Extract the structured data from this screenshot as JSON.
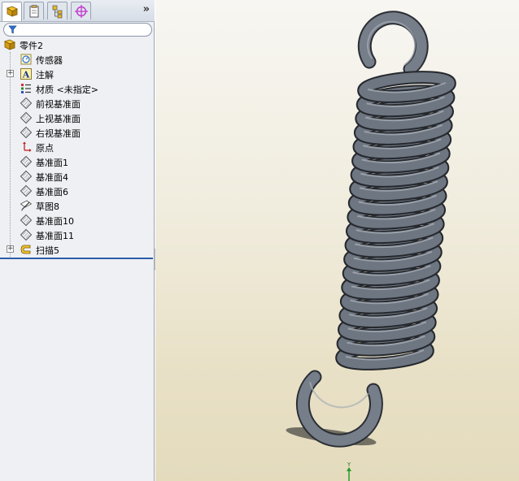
{
  "tabs": [
    {
      "name": "feature-manager",
      "icon": "feature-tree-icon"
    },
    {
      "name": "property-manager",
      "icon": "property-icon"
    },
    {
      "name": "configuration-manager",
      "icon": "configuration-icon"
    },
    {
      "name": "dimxpert-manager",
      "icon": "target-icon"
    }
  ],
  "filter": {
    "placeholder": ""
  },
  "tree": {
    "root": "零件2",
    "items": [
      {
        "label": "传感器",
        "icon": "sensor-icon",
        "expandable": false
      },
      {
        "label": "注解",
        "icon": "annotation-icon",
        "expandable": true
      },
      {
        "label": "材质 <未指定>",
        "icon": "material-icon",
        "expandable": false
      },
      {
        "label": "前视基准面",
        "icon": "plane-icon",
        "expandable": false
      },
      {
        "label": "上视基准面",
        "icon": "plane-icon",
        "expandable": false
      },
      {
        "label": "右视基准面",
        "icon": "plane-icon",
        "expandable": false
      },
      {
        "label": "原点",
        "icon": "origin-icon",
        "expandable": false
      },
      {
        "label": "基准面1",
        "icon": "plane-icon",
        "expandable": false
      },
      {
        "label": "基准面4",
        "icon": "plane-icon",
        "expandable": false
      },
      {
        "label": "基准面6",
        "icon": "plane-icon",
        "expandable": false
      },
      {
        "label": "草图8",
        "icon": "sketch-icon",
        "expandable": false
      },
      {
        "label": "基准面10",
        "icon": "plane-icon",
        "expandable": false
      },
      {
        "label": "基准面11",
        "icon": "plane-icon",
        "expandable": false
      },
      {
        "label": "扫描5",
        "icon": "sweep-icon",
        "expandable": true
      }
    ]
  },
  "axis_label": "Y",
  "colors": {
    "spring": "#6e7682",
    "background": "#f0ecdd",
    "selection": "#2c5ea8"
  }
}
